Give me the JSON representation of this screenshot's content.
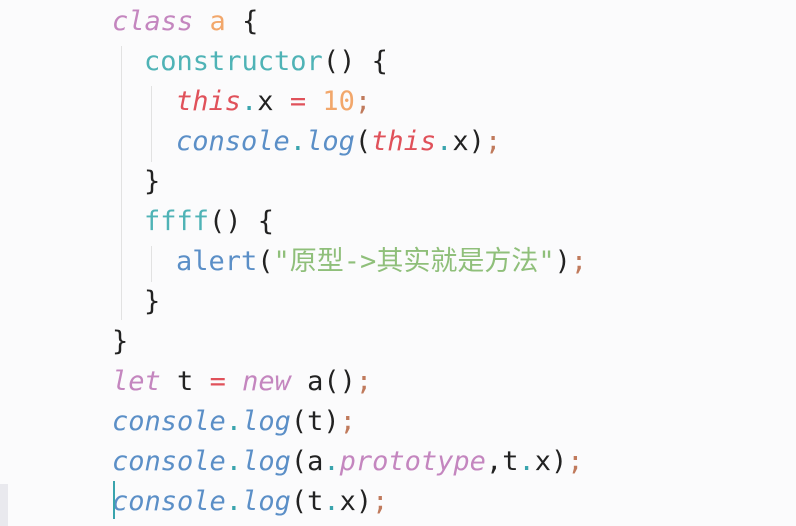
{
  "editor": {
    "lines": [
      {
        "indent": 0,
        "tokens": [
          {
            "t": "class",
            "c": "kw",
            "n": "keyword-class"
          },
          {
            "t": " ",
            "c": "plain",
            "n": "space"
          },
          {
            "t": "a",
            "c": "cls",
            "n": "class-name"
          },
          {
            "t": " {",
            "c": "pun",
            "n": "brace-open"
          }
        ]
      },
      {
        "indent": 1,
        "tokens": [
          {
            "t": "constructor",
            "c": "fn",
            "n": "constructor-name"
          },
          {
            "t": "() {",
            "c": "pun",
            "n": "parens-brace"
          }
        ]
      },
      {
        "indent": 2,
        "tokens": [
          {
            "t": "this",
            "c": "this",
            "n": "keyword-this"
          },
          {
            "t": ".",
            "c": "dot",
            "n": "dot"
          },
          {
            "t": "x",
            "c": "plain",
            "n": "property-x"
          },
          {
            "t": " ",
            "c": "plain",
            "n": "space"
          },
          {
            "t": "=",
            "c": "op",
            "n": "assign-operator"
          },
          {
            "t": " ",
            "c": "plain",
            "n": "space"
          },
          {
            "t": "10",
            "c": "num",
            "n": "number-literal"
          },
          {
            "t": ";",
            "c": "semi",
            "n": "semicolon"
          }
        ]
      },
      {
        "indent": 2,
        "tokens": [
          {
            "t": "console",
            "c": "obj",
            "n": "console-object"
          },
          {
            "t": ".",
            "c": "dot",
            "n": "dot"
          },
          {
            "t": "log",
            "c": "meth",
            "n": "log-method"
          },
          {
            "t": "(",
            "c": "pun",
            "n": "paren-open"
          },
          {
            "t": "this",
            "c": "this",
            "n": "keyword-this"
          },
          {
            "t": ".",
            "c": "dot",
            "n": "dot"
          },
          {
            "t": "x",
            "c": "plain",
            "n": "property-x"
          },
          {
            "t": ")",
            "c": "pun",
            "n": "paren-close"
          },
          {
            "t": ";",
            "c": "semi",
            "n": "semicolon"
          }
        ]
      },
      {
        "indent": 1,
        "tokens": [
          {
            "t": "}",
            "c": "pun",
            "n": "brace-close"
          }
        ]
      },
      {
        "indent": 1,
        "tokens": [
          {
            "t": "ffff",
            "c": "fn",
            "n": "method-name"
          },
          {
            "t": "() {",
            "c": "pun",
            "n": "parens-brace"
          }
        ]
      },
      {
        "indent": 2,
        "tokens": [
          {
            "t": "alert",
            "c": "call",
            "n": "alert-call"
          },
          {
            "t": "(",
            "c": "pun",
            "n": "paren-open"
          },
          {
            "t": "\"原型->其实就是方法\"",
            "c": "str",
            "n": "string-literal"
          },
          {
            "t": ")",
            "c": "pun",
            "n": "paren-close"
          },
          {
            "t": ";",
            "c": "semi",
            "n": "semicolon"
          }
        ]
      },
      {
        "indent": 1,
        "tokens": [
          {
            "t": "}",
            "c": "pun",
            "n": "brace-close"
          }
        ]
      },
      {
        "indent": 0,
        "tokens": [
          {
            "t": "}",
            "c": "pun",
            "n": "brace-close"
          }
        ]
      },
      {
        "indent": 0,
        "tokens": [
          {
            "t": "let",
            "c": "kw",
            "n": "keyword-let"
          },
          {
            "t": " t ",
            "c": "plain",
            "n": "variable-t"
          },
          {
            "t": "=",
            "c": "op",
            "n": "assign-operator"
          },
          {
            "t": " ",
            "c": "plain",
            "n": "space"
          },
          {
            "t": "new",
            "c": "kw",
            "n": "keyword-new"
          },
          {
            "t": " a()",
            "c": "plain",
            "n": "constructor-call"
          },
          {
            "t": ";",
            "c": "semi",
            "n": "semicolon"
          }
        ]
      },
      {
        "indent": 0,
        "tokens": [
          {
            "t": "console",
            "c": "obj",
            "n": "console-object"
          },
          {
            "t": ".",
            "c": "dot",
            "n": "dot"
          },
          {
            "t": "log",
            "c": "meth",
            "n": "log-method"
          },
          {
            "t": "(t)",
            "c": "pun",
            "n": "call-args"
          },
          {
            "t": ";",
            "c": "semi",
            "n": "semicolon"
          }
        ]
      },
      {
        "indent": 0,
        "tokens": [
          {
            "t": "console",
            "c": "obj",
            "n": "console-object"
          },
          {
            "t": ".",
            "c": "dot",
            "n": "dot"
          },
          {
            "t": "log",
            "c": "meth",
            "n": "log-method"
          },
          {
            "t": "(a",
            "c": "pun",
            "n": "call-args"
          },
          {
            "t": ".",
            "c": "dot",
            "n": "dot"
          },
          {
            "t": "prototype",
            "c": "prop",
            "n": "prototype-property"
          },
          {
            "t": ",t",
            "c": "pun",
            "n": "call-args"
          },
          {
            "t": ".",
            "c": "dot",
            "n": "dot"
          },
          {
            "t": "x)",
            "c": "pun",
            "n": "call-args"
          },
          {
            "t": ";",
            "c": "semi",
            "n": "semicolon"
          }
        ]
      },
      {
        "indent": 0,
        "tokens": [
          {
            "t": "console",
            "c": "obj",
            "n": "console-object"
          },
          {
            "t": ".",
            "c": "dot",
            "n": "dot"
          },
          {
            "t": "log",
            "c": "meth",
            "n": "log-method"
          },
          {
            "t": "(t",
            "c": "pun",
            "n": "call-args"
          },
          {
            "t": ".",
            "c": "dot",
            "n": "dot"
          },
          {
            "t": "x)",
            "c": "pun",
            "n": "call-args"
          },
          {
            "t": ";",
            "c": "semi",
            "n": "semicolon"
          }
        ]
      }
    ]
  }
}
